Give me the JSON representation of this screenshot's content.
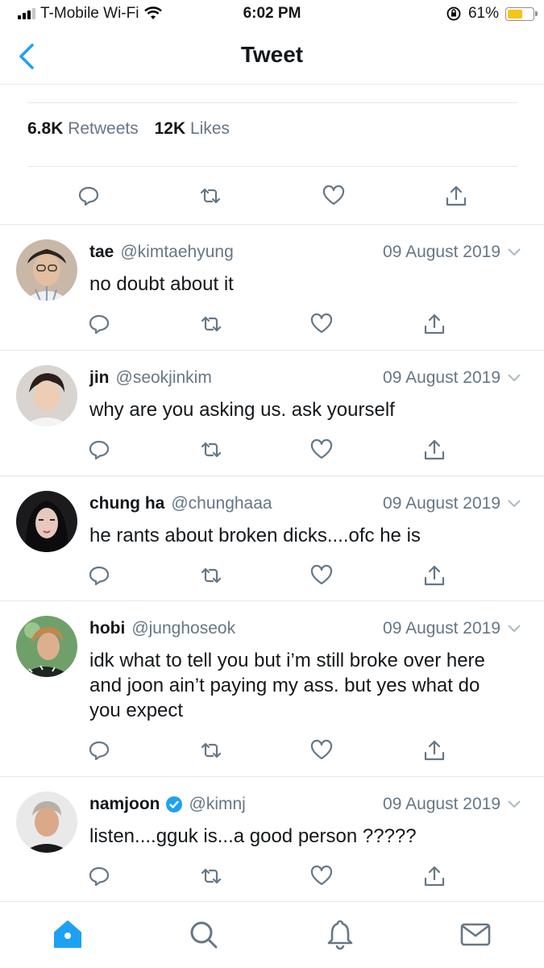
{
  "status_bar": {
    "carrier": "T-Mobile Wi-Fi",
    "time": "6:02 PM",
    "battery": "61%",
    "battery_level": 0.61
  },
  "nav": {
    "title": "Tweet"
  },
  "stats": {
    "retweets_count": "6.8K",
    "retweets_label": "Retweets",
    "likes_count": "12K",
    "likes_label": "Likes"
  },
  "colors": {
    "accent": "#1da1f2",
    "muted": "#657786",
    "divider": "#e1e8ed",
    "battery": "#f5c518"
  },
  "replies": [
    {
      "name": "tae",
      "handle": "@kimtaehyung",
      "date": "09 August 2019",
      "text": "no doubt about it",
      "verified": false
    },
    {
      "name": "jin",
      "handle": "@seokjinkim",
      "date": "09 August 2019",
      "text": "why are you asking us. ask yourself",
      "verified": false
    },
    {
      "name": "chung ha",
      "handle": "@chunghaaa",
      "date": "09 August 2019",
      "text": "he rants about broken dicks....ofc he is",
      "verified": false
    },
    {
      "name": "hobi",
      "handle": "@junghoseok",
      "date": "09 August 2019",
      "text": "idk what to tell you but i’m still broke over here and joon ain’t paying my ass. but yes what do you expect",
      "verified": false
    },
    {
      "name": "namjoon",
      "handle": "@kimnj",
      "date": "09 August 2019",
      "text": "listen....gguk is...a good person ?????",
      "verified": true
    }
  ],
  "tabbar": {
    "tabs": [
      "home-icon",
      "search-icon",
      "notifications-icon",
      "messages-icon"
    ],
    "active": "home-icon"
  }
}
